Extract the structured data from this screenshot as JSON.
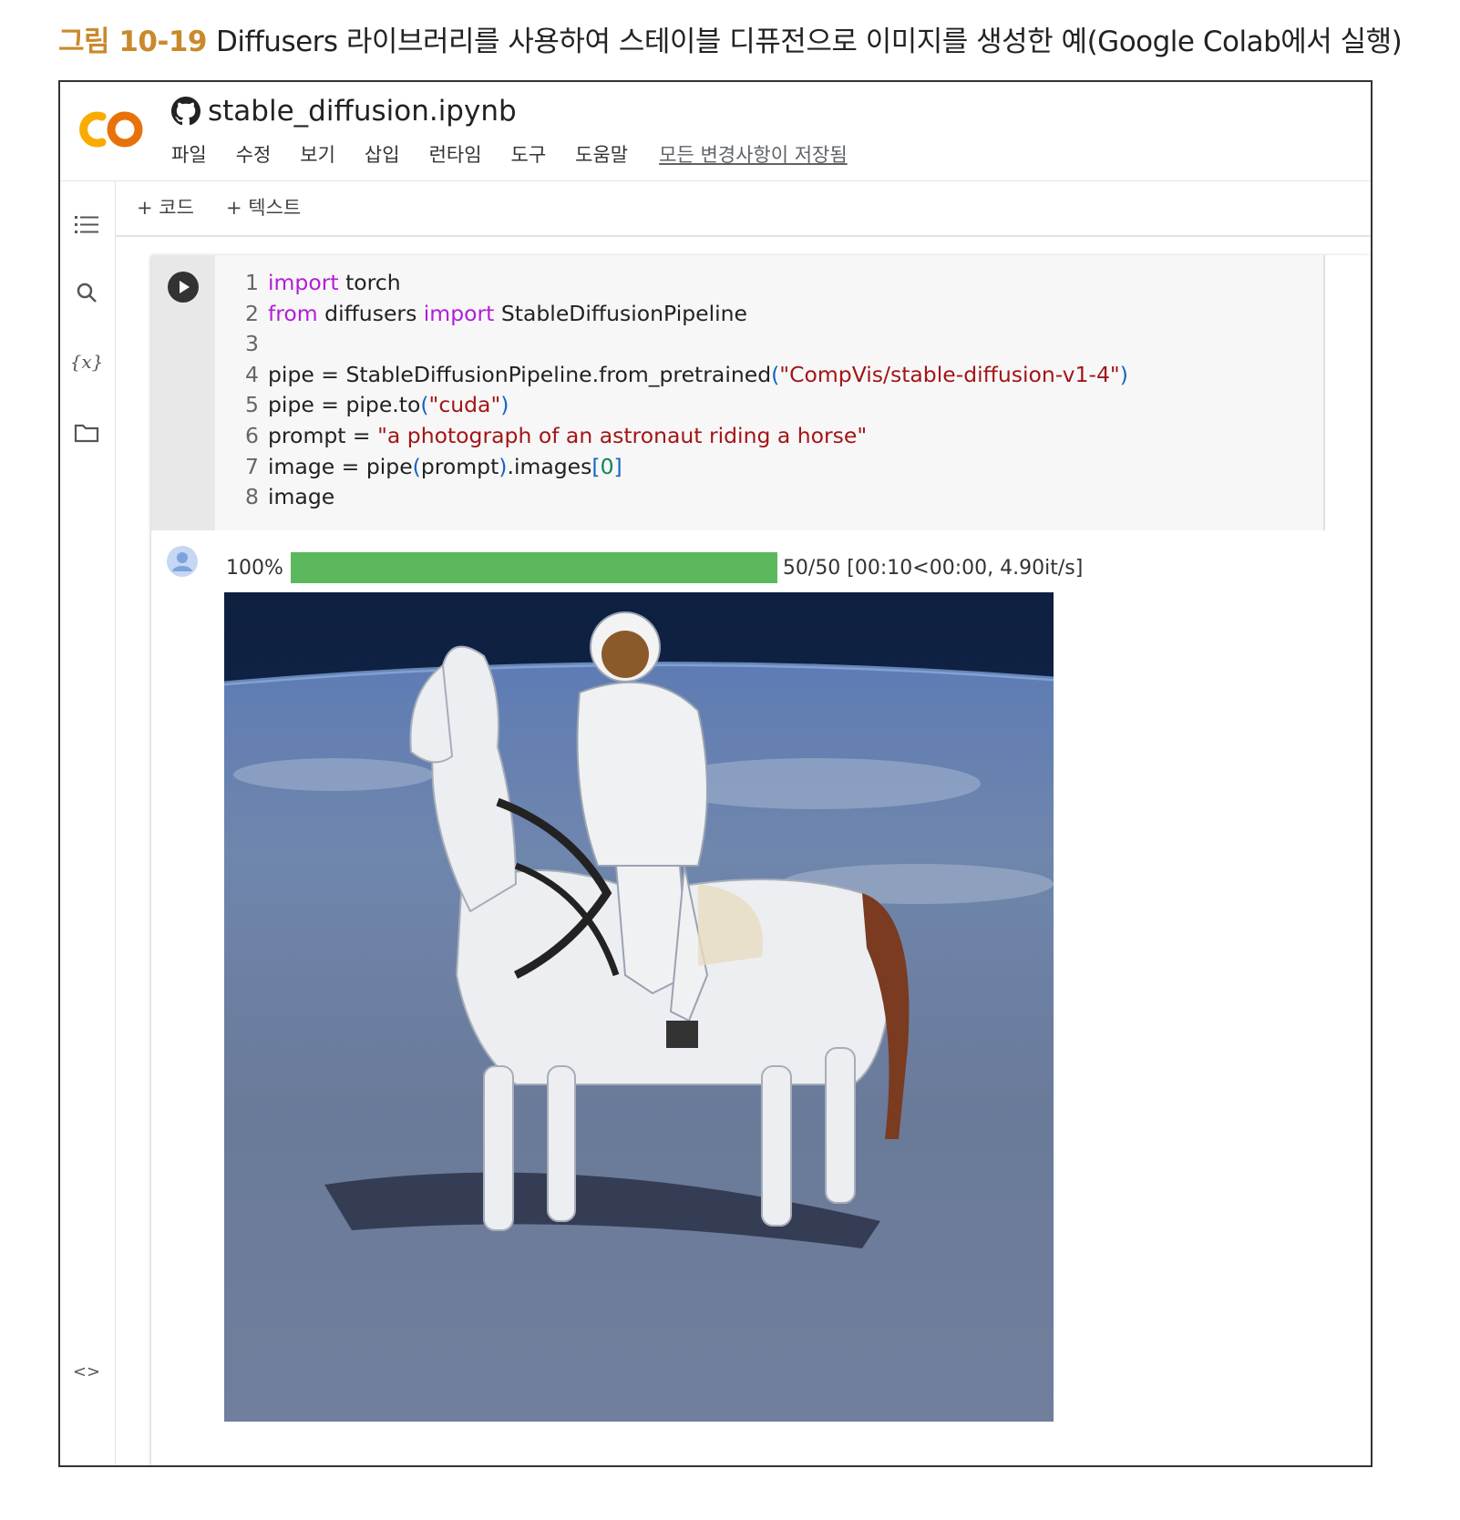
{
  "caption": {
    "figure_label": "그림 10-19",
    "text": "Diffusers 라이브러리를 사용하여 스테이블 디퓨전으로 이미지를 생성한 예(Google Colab에서 실행)"
  },
  "colab": {
    "logo_text": "CO",
    "notebook_title": "stable_diffusion.ipynb",
    "menu": [
      "파일",
      "수정",
      "보기",
      "삽입",
      "런타임",
      "도구",
      "도움말"
    ],
    "save_status": "모든 변경사항이 저장됨",
    "toolbar": {
      "add_code": "+ 코드",
      "add_text": "+ 텍스트"
    },
    "sidebar_icons": [
      "table-of-contents-icon",
      "search-icon",
      "variables-icon",
      "folder-icon",
      "code-snippets-icon"
    ],
    "sidebar_variables_label": "{x}",
    "sidebar_snippets_label": "<>",
    "cell": {
      "code_lines": [
        "import torch",
        "from diffusers import StableDiffusionPipeline",
        "",
        "pipe = StableDiffusionPipeline.from_pretrained(\"CompVis/stable-diffusion-v1-4\")",
        "pipe = pipe.to(\"cuda\")",
        "prompt = \"a photograph of an astronaut riding a horse\"",
        "image = pipe(prompt).images[0]",
        "image"
      ],
      "output": {
        "progress_percent_label": "100%",
        "progress_value": 1.0,
        "progress_stats": "50/50 [00:10<00:00, 4.90it/s]",
        "progress_color": "#5cb85c"
      }
    }
  },
  "colors": {
    "caption_label": "#c98a2c",
    "keyword": "#b11ed8",
    "string": "#a31515"
  }
}
